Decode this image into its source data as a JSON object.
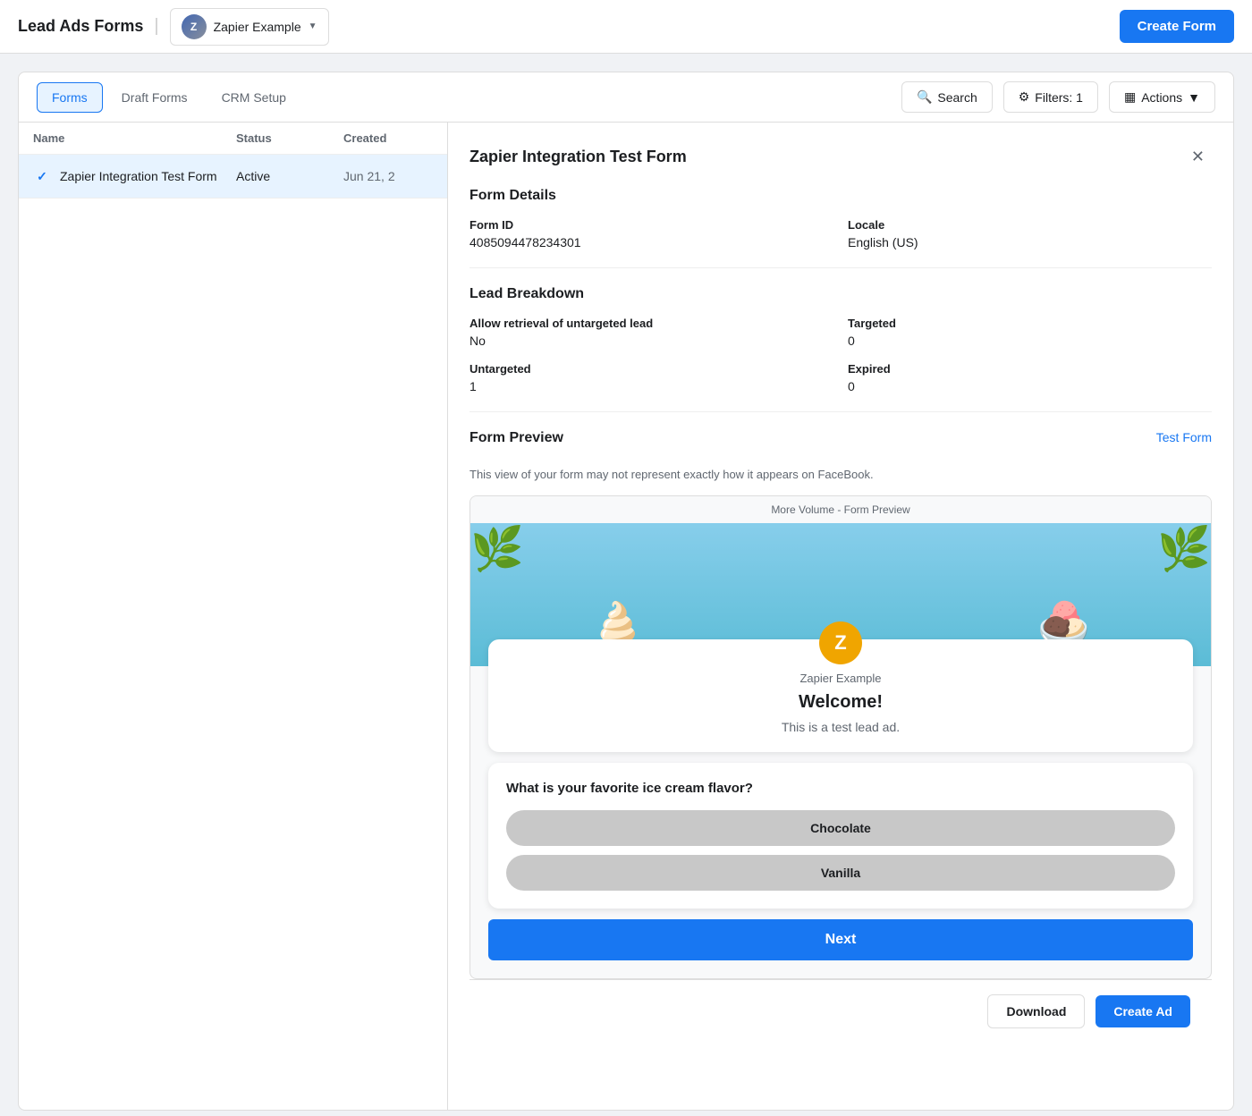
{
  "topbar": {
    "title": "Lead Ads Forms",
    "divider": "|",
    "page": {
      "name": "Zapier Example",
      "icon_letter": "Z"
    },
    "create_form_label": "Create Form"
  },
  "tabs": {
    "forms_label": "Forms",
    "draft_forms_label": "Draft Forms",
    "crm_setup_label": "CRM Setup",
    "search_label": "Search",
    "filters_label": "Filters: 1",
    "actions_label": "Actions"
  },
  "table": {
    "headers": {
      "name": "Name",
      "status": "Status",
      "created": "Created"
    },
    "rows": [
      {
        "name": "Zapier Integration Test Form",
        "status": "Active",
        "created": "Jun 21, 2"
      }
    ]
  },
  "detail": {
    "title": "Zapier Integration Test Form",
    "form_details_section": "Form Details",
    "form_id_label": "Form ID",
    "form_id_value": "4085094478234301",
    "locale_label": "Locale",
    "locale_value": "English (US)",
    "lead_breakdown_section": "Lead Breakdown",
    "allow_retrieval_label": "Allow retrieval of untargeted lead",
    "allow_retrieval_value": "No",
    "targeted_label": "Targeted",
    "targeted_value": "0",
    "untargeted_label": "Untargeted",
    "untargeted_value": "1",
    "expired_label": "Expired",
    "expired_value": "0",
    "form_preview_section": "Form Preview",
    "form_preview_desc": "This view of your form may not represent exactly how it appears on FaceBook.",
    "test_form_label": "Test Form",
    "preview_label": "More Volume - Form Preview",
    "company_name": "Zapier Example",
    "company_letter": "Z",
    "welcome_title": "Welcome!",
    "welcome_desc": "This is a test lead ad.",
    "question_text": "What is your favorite ice cream flavor?",
    "choice_1": "Chocolate",
    "choice_2": "Vanilla",
    "next_label": "Next"
  },
  "bottom": {
    "download_label": "Download",
    "create_ad_label": "Create Ad"
  }
}
